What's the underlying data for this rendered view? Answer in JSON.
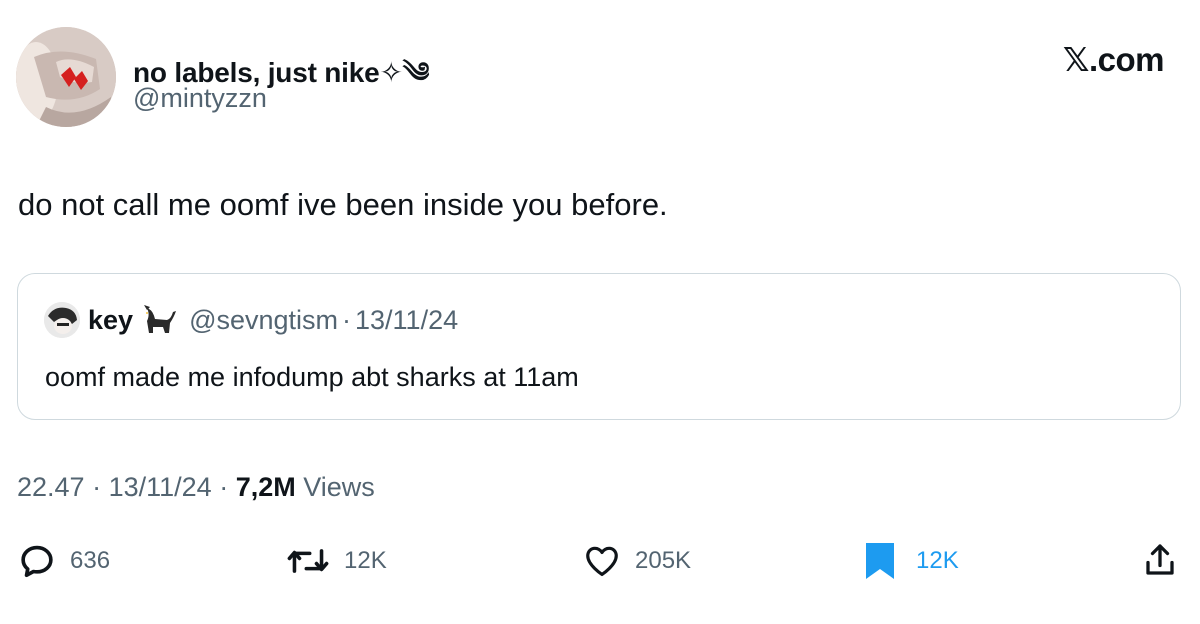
{
  "author": {
    "display_name": "no labels, just nike✧༄",
    "handle": "@mintyzzn"
  },
  "brand": "𝕏.com",
  "tweet": {
    "text": "do not call me oomf ive been inside you before."
  },
  "quote": {
    "name": "key",
    "handle": "@sevngtism",
    "separator": "·",
    "date": "13/11/24",
    "text": "oomf made me infodump abt sharks at 11am"
  },
  "meta": {
    "time": "22.47",
    "date": "13/11/24",
    "views_count": "7,2M",
    "views_label": "Views"
  },
  "actions": {
    "replies": "636",
    "retweets": "12K",
    "likes": "205K",
    "bookmarks": "12K"
  },
  "colors": {
    "text": "#0f1419",
    "secondary": "#536471",
    "accent": "#1d9bf0",
    "border": "#cfd9de"
  },
  "icons": [
    "reply-icon",
    "retweet-icon",
    "heart-icon",
    "bookmark-icon",
    "share-icon",
    "cat-emoji-icon"
  ]
}
